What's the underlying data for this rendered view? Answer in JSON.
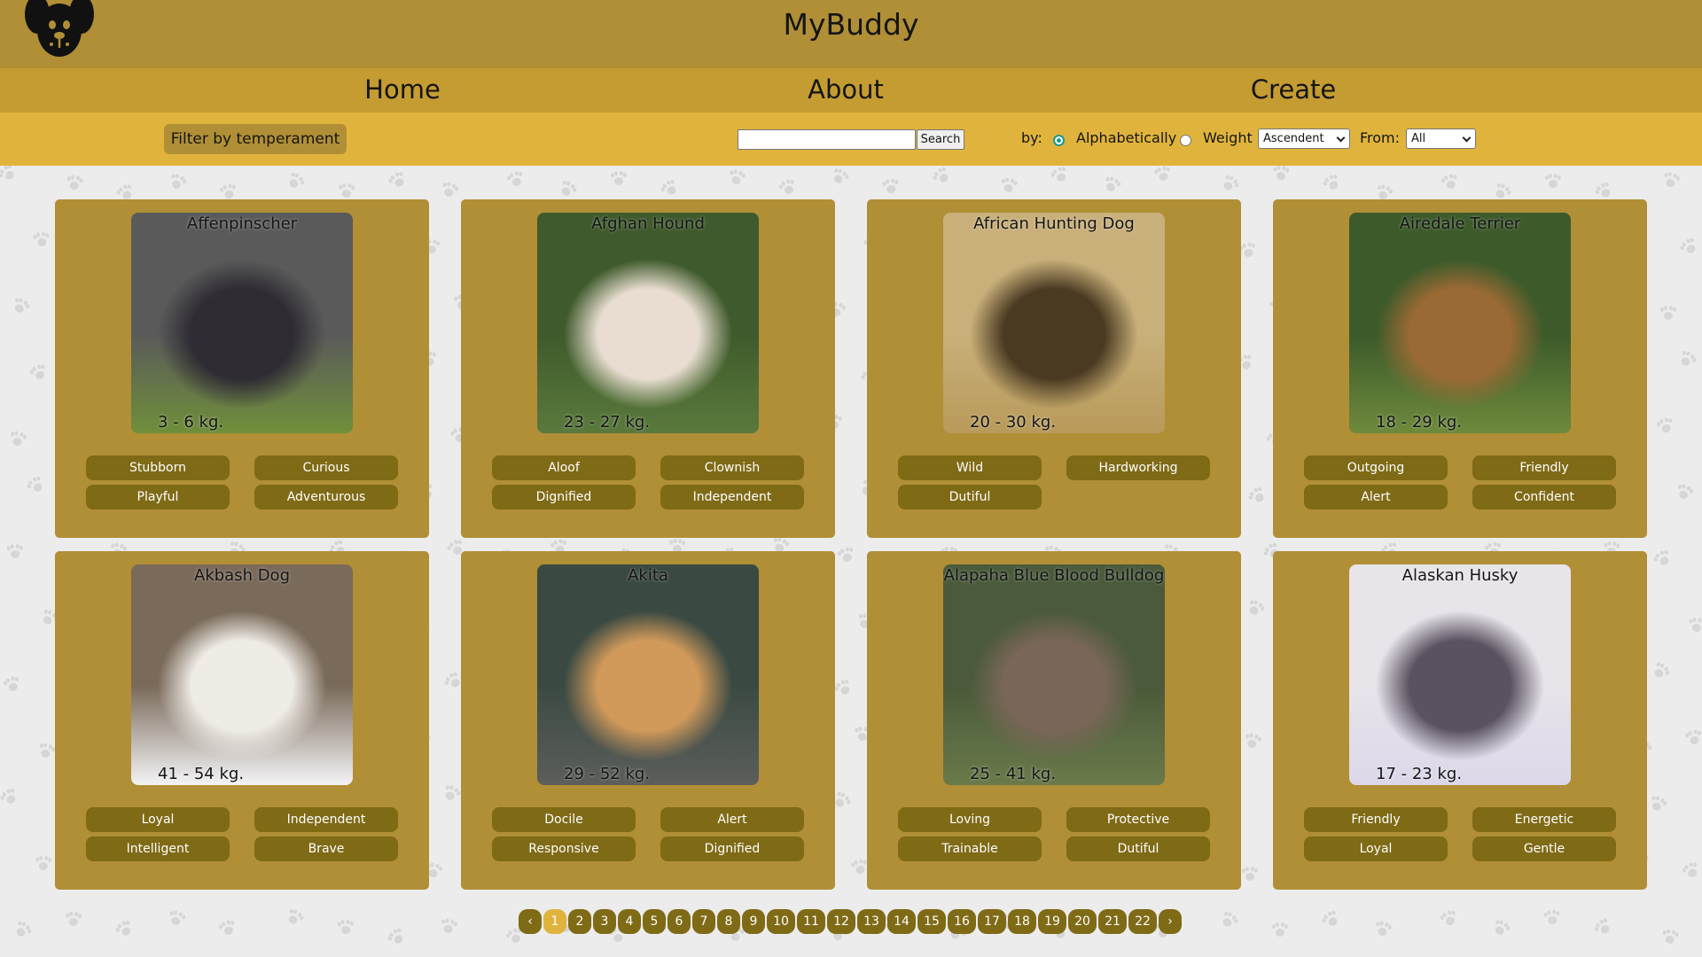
{
  "app": {
    "title": "MyBuddy",
    "logo_icon": "dog-face-icon"
  },
  "nav": {
    "items": [
      "Home",
      "About",
      "Create"
    ]
  },
  "filters": {
    "temperament_button": "Filter by temperament",
    "search": {
      "value": "",
      "placeholder": "",
      "button": "Search"
    },
    "sort_by_label": "by:",
    "sort_options": [
      "Alphabetically",
      "Weight"
    ],
    "sort_selected": "Alphabetically",
    "order_value": "Ascendent",
    "from_label": "From:",
    "from_value": "All"
  },
  "breeds": [
    {
      "name": "Affenpinscher",
      "weight": "3 - 6 kg.",
      "temperaments": [
        "Stubborn",
        "Curious",
        "Playful",
        "Adventurous"
      ],
      "colors": [
        "#5a5a5a",
        "#2e2b33",
        "#6f8f3a"
      ]
    },
    {
      "name": "Afghan Hound",
      "weight": "23 - 27 kg.",
      "temperaments": [
        "Aloof",
        "Clownish",
        "Dignified",
        "Independent"
      ],
      "colors": [
        "#3f5a2c",
        "#e8ddd0",
        "#5a7a3c"
      ]
    },
    {
      "name": "African Hunting Dog",
      "weight": "20 - 30 kg.",
      "temperaments": [
        "Wild",
        "Hardworking",
        "Dutiful"
      ],
      "colors": [
        "#c9b07a",
        "#4a3a22",
        "#b89a5a"
      ]
    },
    {
      "name": "Airedale Terrier",
      "weight": "18 - 29 kg.",
      "temperaments": [
        "Outgoing",
        "Friendly",
        "Alert",
        "Confident"
      ],
      "colors": [
        "#3c5a2a",
        "#9a6a34",
        "#6e8a3c"
      ]
    },
    {
      "name": "Akbash Dog",
      "weight": "41 - 54 kg.",
      "temperaments": [
        "Loyal",
        "Independent",
        "Intelligent",
        "Brave"
      ],
      "colors": [
        "#7a6a5a",
        "#efece6",
        "#f4f4f6"
      ]
    },
    {
      "name": "Akita",
      "weight": "29 - 52 kg.",
      "temperaments": [
        "Docile",
        "Alert",
        "Responsive",
        "Dignified"
      ],
      "colors": [
        "#3a4a42",
        "#d29a5a",
        "#5c5e5a"
      ]
    },
    {
      "name": "Alapaha Blue Blood Bulldog",
      "weight": "25 - 41 kg.",
      "temperaments": [
        "Loving",
        "Protective",
        "Trainable",
        "Dutiful"
      ],
      "colors": [
        "#4a5a3a",
        "#7a6658",
        "#6a7a4a"
      ]
    },
    {
      "name": "Alaskan Husky",
      "weight": "17 - 23 kg.",
      "temperaments": [
        "Friendly",
        "Energetic",
        "Loyal",
        "Gentle"
      ],
      "colors": [
        "#e8e4ea",
        "#5a5260",
        "#dcd8ea"
      ]
    }
  ],
  "pagination": {
    "prev": "‹",
    "next": "›",
    "pages": [
      "1",
      "2",
      "3",
      "4",
      "5",
      "6",
      "7",
      "8",
      "9",
      "10",
      "11",
      "12",
      "13",
      "14",
      "15",
      "16",
      "17",
      "18",
      "19",
      "20",
      "21",
      "22"
    ],
    "current": "1"
  },
  "theme": {
    "header": "#b08f36",
    "nav": "#c49c32",
    "filterbar": "#e0b43c",
    "card": "#b08f36",
    "tag": "#7f6a16"
  }
}
